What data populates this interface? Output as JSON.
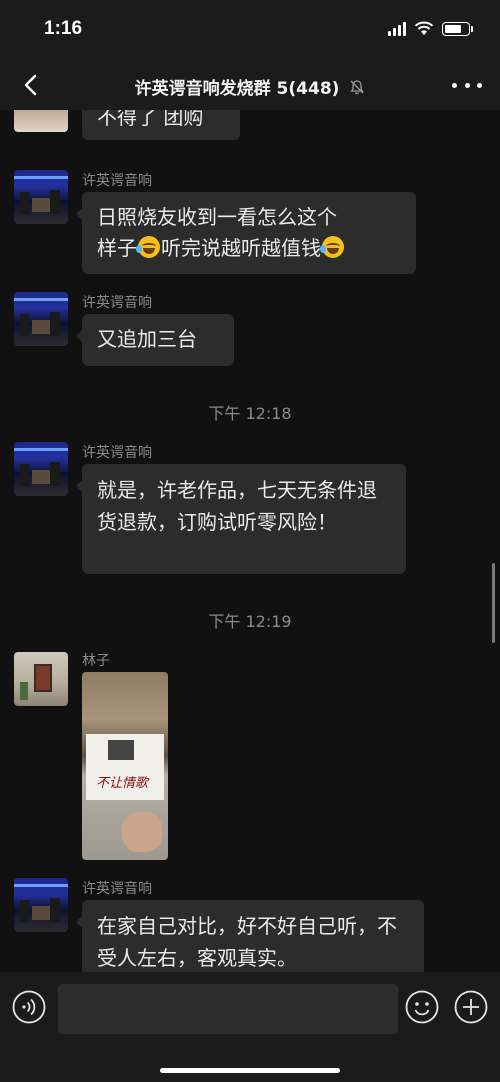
{
  "status_bar": {
    "time": "1:16",
    "icons": [
      "signal-icon",
      "wifi-icon",
      "battery-icon"
    ]
  },
  "nav": {
    "back_icon": "chevron-left-icon",
    "title": "许英谔音响发烧群 5(448)",
    "mute_icon": "bell-slash-icon",
    "more_icon": "more-dots-icon"
  },
  "messages": [
    {
      "sender": "",
      "text": "不得了 团购"
    },
    {
      "sender": "许英谔音响",
      "text_a": "日照烧友收到一看怎么这个",
      "text_b": "样子",
      "text_c": "听完说越听越值钱",
      "emoji": "laughing-crying-emoji"
    },
    {
      "sender": "许英谔音响",
      "text": "又追加三台"
    },
    {
      "sender": "许英谔音响",
      "text": "就是，许老作品，七天无条件退货退款，订购试听零风险！"
    },
    {
      "sender": "林子",
      "photo_caption": "不让情歌"
    },
    {
      "sender": "许英谔音响",
      "text": "在家自己对比，好不好自己听，不受人左右，客观真实。"
    }
  ],
  "timestamps": [
    "下午 12:18",
    "下午 12:19"
  ],
  "input_bar": {
    "voice_icon": "voice-icon",
    "emoji_icon": "emoji-icon",
    "plus_icon": "plus-icon",
    "placeholder": ""
  },
  "colors": {
    "background": "#111111",
    "bubble": "#2c2c2c",
    "bar": "#1b1b1b",
    "muted_text": "#8a8a8a"
  }
}
